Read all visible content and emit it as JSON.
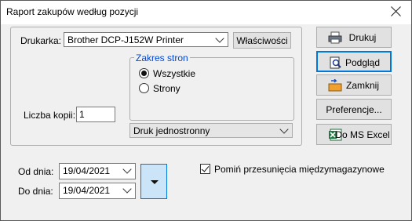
{
  "window": {
    "title": "Raport zakupów według pozycji"
  },
  "printer": {
    "label": "Drukarka:",
    "value": "Brother DCP-J152W Printer",
    "properties_label": "Właściwości"
  },
  "copies": {
    "label": "Liczba kopii:",
    "value": "1"
  },
  "page_range": {
    "legend": "Zakres stron",
    "all_label": "Wszystkie",
    "pages_label": "Strony",
    "selected": "all"
  },
  "duplex": {
    "value": "Druk jednostronny"
  },
  "dates": {
    "from_label": "Od dnia:",
    "from_value": "19/04/2021",
    "to_label": "Do dnia:",
    "to_value": "19/04/2021"
  },
  "skip_option": {
    "label": "Pomiń przesunięcia międzymagazynowe",
    "checked": true
  },
  "side_buttons": {
    "print": "Drukuj",
    "preview": "Podgląd",
    "close": "Zamknij",
    "preferences": "Preferencje...",
    "excel": "Do MS Excel"
  }
}
